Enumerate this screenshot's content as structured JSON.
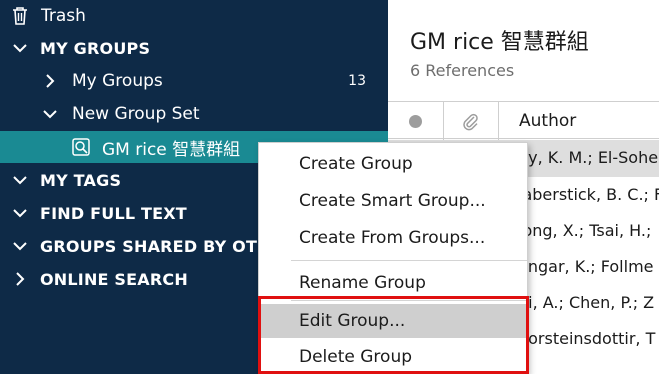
{
  "sidebar": {
    "trash": "Trash",
    "my_groups_header": "MY GROUPS",
    "my_groups": {
      "label": "My Groups",
      "count": "13"
    },
    "group_set": "New Group Set",
    "selected_group": "GM rice 智慧群組",
    "my_tags": "MY TAGS",
    "find_full_text": "FIND FULL TEXT",
    "groups_shared": "GROUPS SHARED BY OTH",
    "online_search": "ONLINE SEARCH"
  },
  "main": {
    "title": "GM rice 智慧群組",
    "subtitle": "6 References",
    "column_author": "Author",
    "rows": [
      "ny, K. M.; El-Sohe",
      "laberstick, B. C.; F",
      "long, X.; Tsai, H.;",
      "engar, K.; Follme",
      "hi, A.; Chen, P.; Z",
      "horsteinsdottir, T"
    ]
  },
  "context_menu": {
    "items": [
      "Create Group",
      "Create Smart Group...",
      "Create From Groups...",
      "Rename Group",
      "Edit Group...",
      "Delete Group"
    ],
    "hovered": "Edit Group..."
  },
  "colors": {
    "sidebar_bg": "#0e2a47",
    "selected_bg": "#1a8a93",
    "highlight_border": "#e01010"
  }
}
